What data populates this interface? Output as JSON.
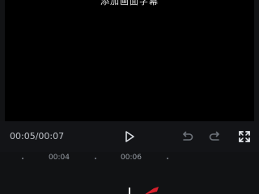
{
  "preview": {
    "caption": "添加画面字幕"
  },
  "controls": {
    "time": "00:05/00:07"
  },
  "ruler": {
    "labels": [
      "00:04",
      "00:06"
    ]
  },
  "colors": {
    "background": "#121315",
    "preview": "#000000",
    "marker_red": "#d61f2c"
  }
}
